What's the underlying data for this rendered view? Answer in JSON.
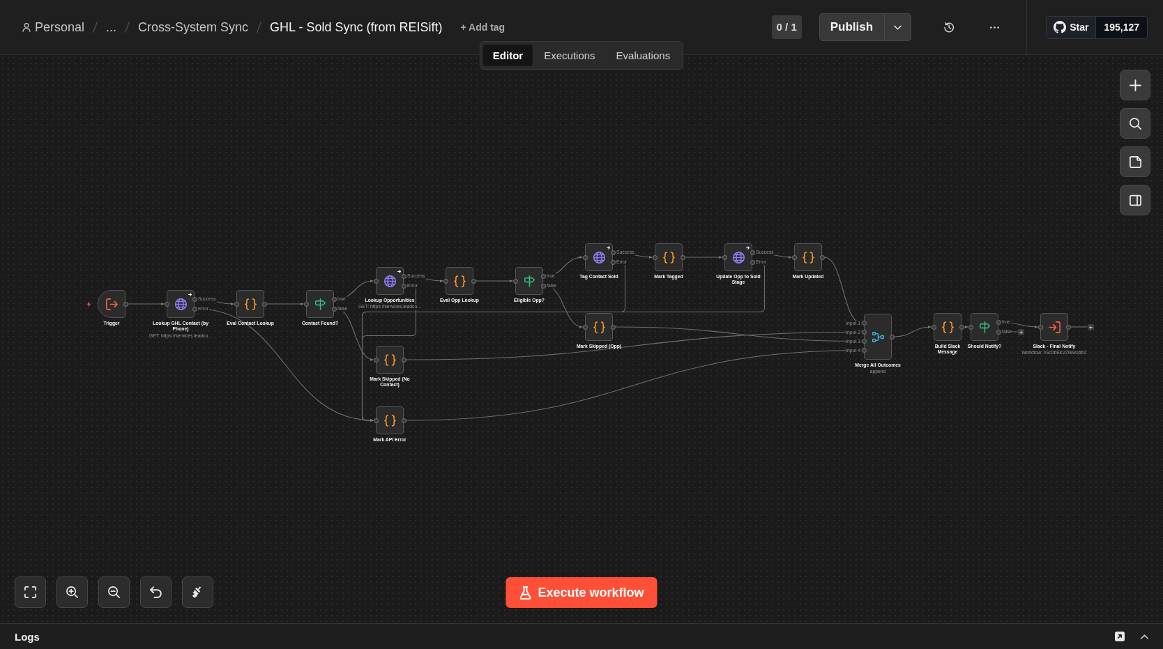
{
  "breadcrumb": {
    "owner": "Personal",
    "path": [
      "...",
      "Cross-System Sync"
    ],
    "workflow_name": "GHL - Sold Sync (from REISift)",
    "add_tag": "+ Add tag"
  },
  "header": {
    "counter": "0 / 1",
    "publish_button": "Publish",
    "github": {
      "label": "Star",
      "count": "195,127"
    }
  },
  "tabs": [
    {
      "label": "Editor",
      "selected": true
    },
    {
      "label": "Executions",
      "selected": false
    },
    {
      "label": "Evaluations",
      "selected": false
    }
  ],
  "nodes": [
    {
      "name": "Trigger",
      "kind": "trigger"
    },
    {
      "name": "Lookup GHL Contact (by Phone)",
      "kind": "http",
      "subtitle": "GET: https://services.leadco...",
      "outputs": [
        "Success",
        "Error"
      ]
    },
    {
      "name": "Eval Contact Lookup",
      "kind": "code"
    },
    {
      "name": "Contact Found?",
      "kind": "if",
      "outputs": [
        "true",
        "false"
      ]
    },
    {
      "name": "Lookup Opportunities",
      "kind": "http",
      "subtitle": "GET: https://services.leadco...",
      "outputs": [
        "Success",
        "Error"
      ]
    },
    {
      "name": "Mark Skipped (No Contact)",
      "kind": "code"
    },
    {
      "name": "Mark API Error",
      "kind": "code"
    },
    {
      "name": "Eval Opp Lookup",
      "kind": "code"
    },
    {
      "name": "Eligible Opp?",
      "kind": "if",
      "outputs": [
        "true",
        "false"
      ]
    },
    {
      "name": "Tag Contact Sold",
      "kind": "http",
      "outputs": [
        "Success",
        "Error"
      ]
    },
    {
      "name": "Mark Tagged",
      "kind": "code"
    },
    {
      "name": "Update Opp to Sold Stage",
      "kind": "http",
      "outputs": [
        "Success",
        "Error"
      ]
    },
    {
      "name": "Mark Skipped (Opp)",
      "kind": "code"
    },
    {
      "name": "Mark Updated",
      "kind": "code"
    },
    {
      "name": "Merge All Outcomes",
      "kind": "merge",
      "subtitle": "append",
      "inputs": [
        "input 1",
        "input 2",
        "input 3",
        "input 4"
      ]
    },
    {
      "name": "Build Slack Message",
      "kind": "code"
    },
    {
      "name": "Should Notify?",
      "kind": "if",
      "outputs": [
        "true",
        "false"
      ]
    },
    {
      "name": "Slack - Final Notify",
      "kind": "workflow",
      "subtitle": "Workflow: rGc0bEkV2Wwo6frZ"
    }
  ],
  "execute_button": "Execute workflow",
  "logs_panel": {
    "title": "Logs"
  }
}
